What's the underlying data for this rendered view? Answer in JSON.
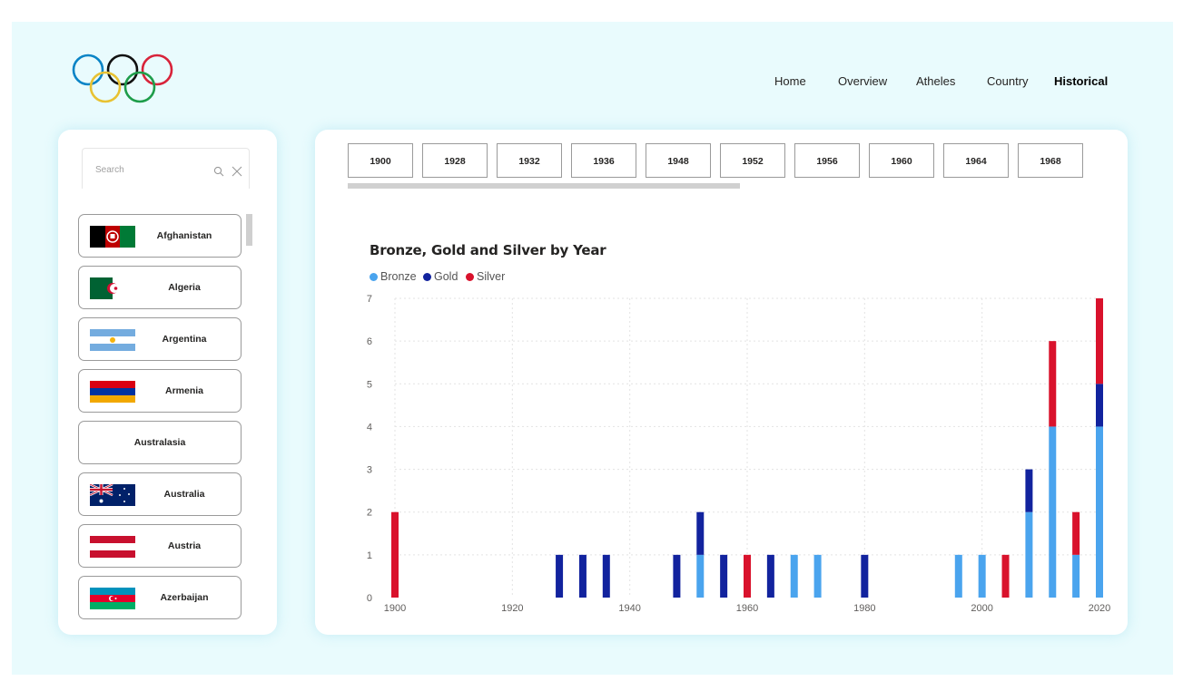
{
  "nav": {
    "items": [
      "Home",
      "Overview",
      "Atheles",
      "Country",
      "Historical"
    ],
    "active": "Historical"
  },
  "search": {
    "placeholder": "Search"
  },
  "countries": [
    {
      "label": "Afghanistan",
      "flag": "afghanistan"
    },
    {
      "label": "Algeria",
      "flag": "algeria"
    },
    {
      "label": "Argentina",
      "flag": "argentina"
    },
    {
      "label": "Armenia",
      "flag": "armenia"
    },
    {
      "label": "Australasia",
      "flag": ""
    },
    {
      "label": "Australia",
      "flag": "australia"
    },
    {
      "label": "Austria",
      "flag": "austria"
    },
    {
      "label": "Azerbaijan",
      "flag": "azerbaijan"
    }
  ],
  "years": [
    "1900",
    "1928",
    "1932",
    "1936",
    "1948",
    "1952",
    "1956",
    "1960",
    "1964",
    "1968"
  ],
  "colors": {
    "bronze": "#4aa4ee",
    "gold": "#12239e",
    "silver": "#d9122c"
  },
  "chart_data": {
    "type": "bar",
    "stacked": true,
    "title": "Bronze, Gold and Silver by Year",
    "x": [
      1900,
      1928,
      1932,
      1936,
      1948,
      1952,
      1956,
      1960,
      1964,
      1968,
      1972,
      1980,
      1996,
      2000,
      2004,
      2008,
      2012,
      2016,
      2020
    ],
    "series": [
      {
        "name": "Bronze",
        "values": [
          0,
          0,
          0,
          0,
          0,
          1,
          0,
          0,
          0,
          1,
          1,
          0,
          1,
          1,
          0,
          2,
          4,
          1,
          4
        ]
      },
      {
        "name": "Gold",
        "values": [
          0,
          1,
          1,
          1,
          1,
          1,
          1,
          0,
          1,
          0,
          0,
          1,
          0,
          0,
          0,
          1,
          0,
          0,
          1
        ]
      },
      {
        "name": "Silver",
        "values": [
          2,
          0,
          0,
          0,
          0,
          0,
          0,
          1,
          0,
          0,
          0,
          0,
          0,
          0,
          1,
          0,
          2,
          1,
          2
        ]
      }
    ],
    "xlim": [
      1900,
      2020
    ],
    "ylim": [
      0,
      7
    ],
    "xticks": [
      1900,
      1920,
      1940,
      1960,
      1980,
      2000,
      2020
    ],
    "yticks": [
      0,
      1,
      2,
      3,
      4,
      5,
      6,
      7
    ],
    "grid": true,
    "legend_position": "top-left"
  }
}
